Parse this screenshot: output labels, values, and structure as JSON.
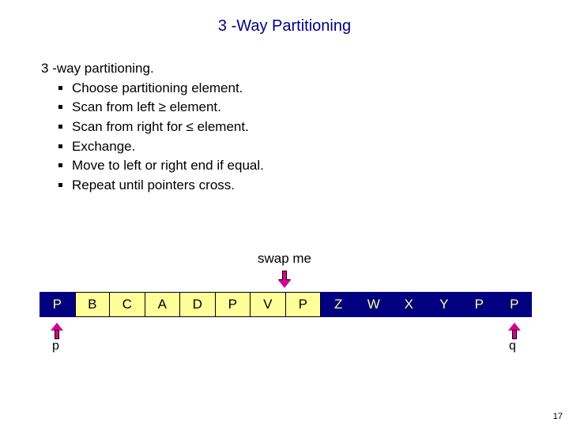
{
  "title": "3 -Way Partitioning",
  "heading": "3 -way partitioning.",
  "bullets": [
    "Choose partitioning element.",
    "Scan from left ≥ element.",
    "Scan from right for ≤  element.",
    "Exchange.",
    "Move to left or right end if equal.",
    "Repeat until pointers cross."
  ],
  "swap_label": "swap me",
  "cells": [
    {
      "v": "P",
      "t": "dark"
    },
    {
      "v": "B",
      "t": "light"
    },
    {
      "v": "C",
      "t": "light"
    },
    {
      "v": "A",
      "t": "light"
    },
    {
      "v": "D",
      "t": "light"
    },
    {
      "v": "P",
      "t": "light"
    },
    {
      "v": "V",
      "t": "light"
    },
    {
      "v": "P",
      "t": "light"
    },
    {
      "v": "Z",
      "t": "dark"
    },
    {
      "v": "W",
      "t": "dark"
    },
    {
      "v": "X",
      "t": "dark"
    },
    {
      "v": "Y",
      "t": "dark"
    },
    {
      "v": "P",
      "t": "dark"
    },
    {
      "v": "P",
      "t": "dark"
    }
  ],
  "pointers": {
    "p": "p",
    "q": "q"
  },
  "page_number": "17"
}
